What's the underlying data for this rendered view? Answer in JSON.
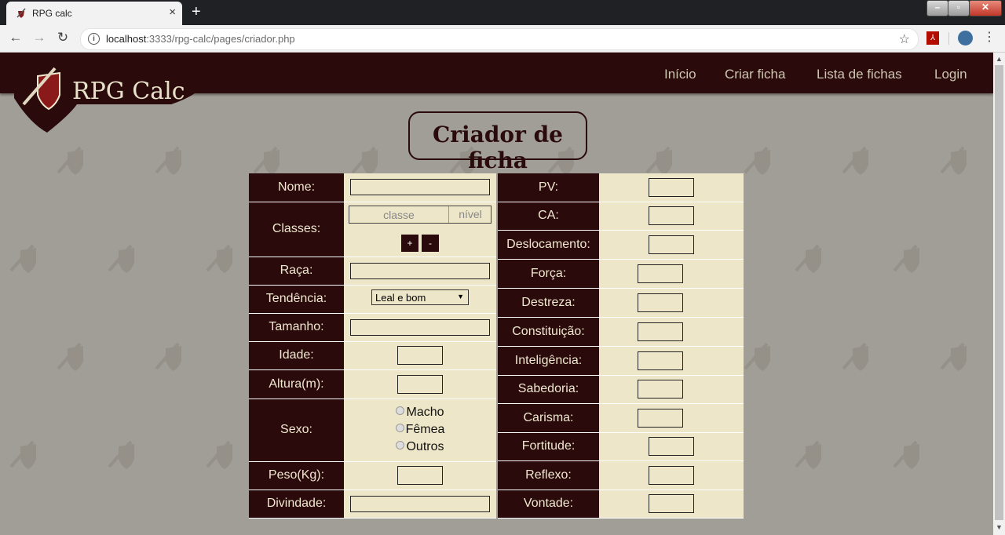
{
  "browser": {
    "tab_title": "RPG calc",
    "tab_close": "×",
    "new_tab": "+",
    "url_host": "localhost",
    "url_rest": ":3333/rpg-calc/pages/criador.php"
  },
  "site": {
    "logo_text": "RPG Calc",
    "nav": [
      "Início",
      "Criar ficha",
      "Lista de fichas",
      "Login"
    ]
  },
  "page_title": "Criador de ficha",
  "left": {
    "nome": "Nome:",
    "classes": "Classes:",
    "classe_placeholder": "classe",
    "nivel_placeholder": "nível",
    "add_btn": "+",
    "remove_btn": "-",
    "raca": "Raça:",
    "tendencia": "Tendência:",
    "tendencia_value": "Leal e bom",
    "tamanho": "Tamanho:",
    "idade": "Idade:",
    "altura": "Altura(m):",
    "sexo": "Sexo:",
    "sexo_options": [
      "Macho",
      "Fêmea",
      "Outros"
    ],
    "peso": "Peso(Kg):",
    "divindade": "Divindade:"
  },
  "right": {
    "pv": "PV:",
    "ca": "CA:",
    "deslocamento": "Deslocamento:",
    "forca": "Força:",
    "destreza": "Destreza:",
    "constituicao": "Constituição:",
    "inteligencia": "Inteligência:",
    "sabedoria": "Sabedoria:",
    "carisma": "Carisma:",
    "fortitude": "Fortitude:",
    "reflexo": "Reflexo:",
    "vontade": "Vontade:"
  },
  "colors": {
    "header": "#2a0a0a",
    "field_bg": "#ede6c8",
    "page_bg": "#a19e97"
  }
}
